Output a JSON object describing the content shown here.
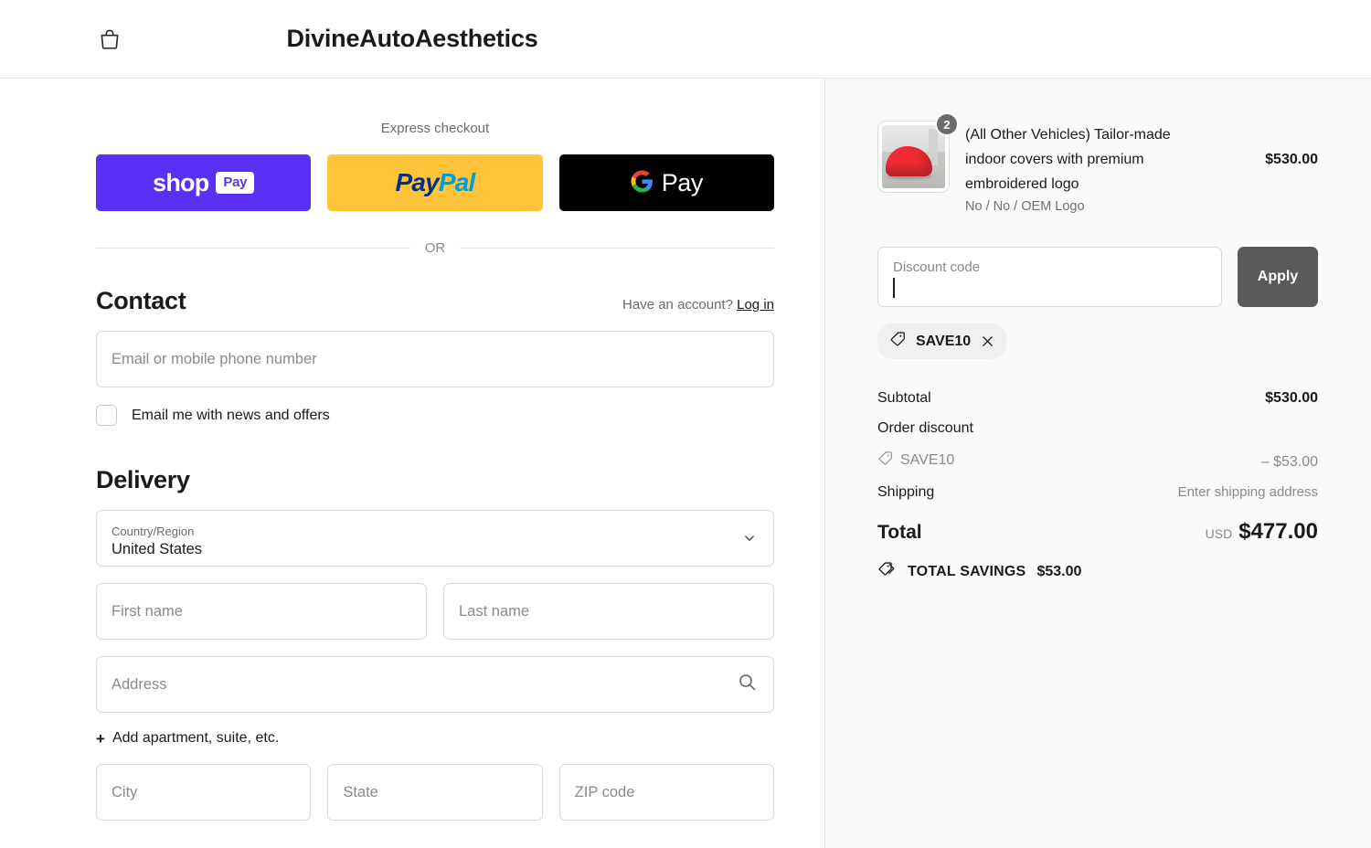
{
  "header": {
    "shop_title": "DivineAutoAesthetics",
    "bag_icon": "shopping-bag-icon"
  },
  "express": {
    "label": "Express checkout",
    "buttons": [
      {
        "name": "shop-pay",
        "word": "shop",
        "pill": "Pay"
      },
      {
        "name": "paypal",
        "part1": "Pay",
        "part2": "Pal"
      },
      {
        "name": "google-pay",
        "word": "Pay"
      }
    ],
    "or": "OR"
  },
  "contact": {
    "title": "Contact",
    "account_prompt": "Have an account?",
    "login_label": "Log in",
    "email_placeholder": "Email or mobile phone number",
    "email_value": "",
    "newsletter_label": "Email me with news and offers",
    "newsletter_checked": false
  },
  "delivery": {
    "title": "Delivery",
    "country_label": "Country/Region",
    "country_value": "United States",
    "first_name_placeholder": "First name",
    "first_name_value": "",
    "last_name_placeholder": "Last name",
    "last_name_value": "",
    "address_placeholder": "Address",
    "address_value": "",
    "add_apartment_label": "Add apartment, suite, etc.",
    "add_apartment_plus": "+",
    "city_placeholder": "City",
    "state_placeholder": "State",
    "zip_placeholder": "ZIP code"
  },
  "order": {
    "product": {
      "title": "(All Other Vehicles) Tailor-made indoor covers with premium embroidered logo",
      "variant": "No / No / OEM Logo",
      "price": "$530.00",
      "quantity": "2"
    },
    "discount": {
      "placeholder": "Discount code",
      "value": "",
      "apply_label": "Apply",
      "applied_code": "SAVE10"
    },
    "summary": {
      "subtotal_label": "Subtotal",
      "subtotal_value": "$530.00",
      "order_discount_label": "Order discount",
      "discount_code_label": "SAVE10",
      "discount_value": "– $53.00",
      "shipping_label": "Shipping",
      "shipping_value": "Enter shipping address",
      "total_label": "Total",
      "currency": "USD",
      "total_value": "$477.00",
      "savings_label": "TOTAL SAVINGS",
      "savings_value": "$53.00"
    }
  },
  "colors": {
    "shop_pay": "#5a31f4",
    "paypal": "#ffc43a",
    "gpay": "#000000",
    "apply_button": "#5a5a5a",
    "panel_bg": "#fafafa"
  }
}
